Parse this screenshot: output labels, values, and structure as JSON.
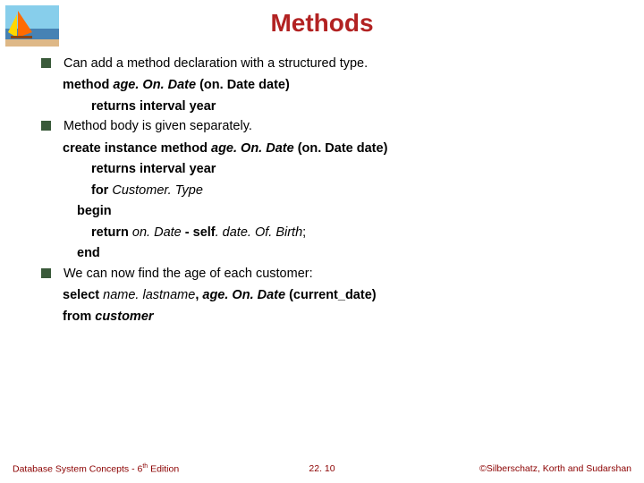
{
  "slide": {
    "title": "Methods",
    "bullets": {
      "b1_text": "Can add a method declaration with a structured type.",
      "b1_l1_pre": "method ",
      "b1_l1_mid": "age. On. Date ",
      "b1_l1_suf": "(on. Date date)",
      "b1_l2": "returns interval year",
      "b2_text": "Method body is given separately.",
      "b2_l1_pre": "create instance method ",
      "b2_l1_mid": "age. On. Date ",
      "b2_l1_suf": "(on. Date date)",
      "b2_l2": "returns interval year",
      "b2_l3_pre": "for ",
      "b2_l3_suf": "Customer. Type",
      "b2_l4": "begin",
      "b2_l5_pre": "return ",
      "b2_l5_mid1": "on. Date ",
      "b2_l5_dash": "- ",
      "b2_l5_self": "self",
      "b2_l5_mid2": ". date. Of. Birth",
      "b2_l5_semi": ";",
      "b2_l6": "end",
      "b3_text": "We can now find the age of each customer:",
      "b3_l1_pre": "select ",
      "b3_l1_mid1": "name. lastname",
      "b3_l1_comma": ", ",
      "b3_l1_mid2": "age. On. Date ",
      "b3_l1_suf": "(current_date)",
      "b3_l2_pre": "from ",
      "b3_l2_suf": "customer"
    }
  },
  "footer": {
    "left_pre": "Database System Concepts - 6",
    "left_sup": "th",
    "left_suf": " Edition",
    "center": "22. 10",
    "right": "©Silberschatz, Korth and Sudarshan"
  }
}
